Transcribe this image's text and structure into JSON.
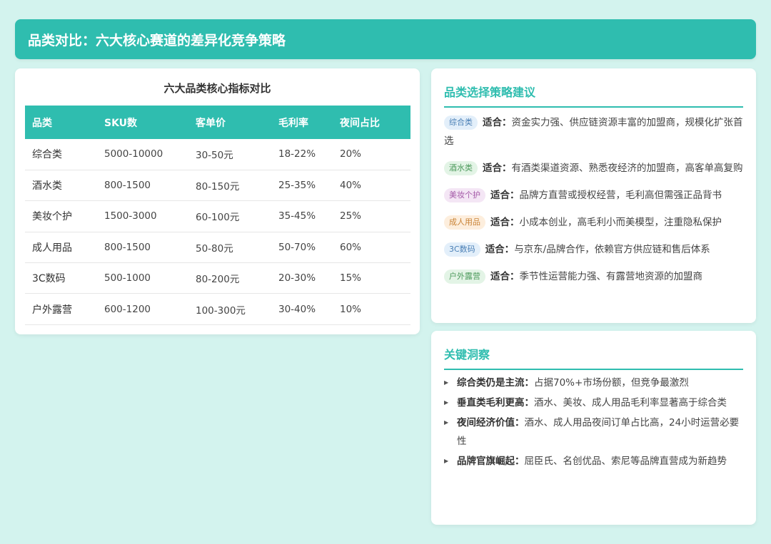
{
  "header": {
    "title": "品类对比：六大核心赛道的差异化竞争策略"
  },
  "table": {
    "title": "六大品类核心指标对比",
    "columns": [
      "品类",
      "SKU数",
      "客单价",
      "毛利率",
      "夜间占比"
    ],
    "rows": [
      [
        "综合类",
        "5000-10000",
        "30-50元",
        "18-22%",
        "20%"
      ],
      [
        "酒水类",
        "800-1500",
        "80-150元",
        "25-35%",
        "40%"
      ],
      [
        "美妆个护",
        "1500-3000",
        "60-100元",
        "35-45%",
        "25%"
      ],
      [
        "成人用品",
        "800-1500",
        "50-80元",
        "50-70%",
        "60%"
      ],
      [
        "3C数码",
        "500-1000",
        "80-200元",
        "20-30%",
        "15%"
      ],
      [
        "户外露营",
        "600-1200",
        "100-300元",
        "30-40%",
        "10%"
      ]
    ]
  },
  "strategy": {
    "title": "品类选择策略建议",
    "fit_label": "适合：",
    "items": [
      {
        "tag": "综合类",
        "text": "资金实力强、供应链资源丰富的加盟商，规模化扩张首选",
        "tag_bg": "#e3effa",
        "tag_color": "#4a7fb5"
      },
      {
        "tag": "酒水类",
        "text": "有酒类渠道资源、熟悉夜经济的加盟商，高客单高复购",
        "tag_bg": "#e3f4e6",
        "tag_color": "#4d9a5c"
      },
      {
        "tag": "美妆个护",
        "text": "品牌方直营或授权经营，毛利高但需强正品背书",
        "tag_bg": "#f4e6f5",
        "tag_color": "#a45aa8"
      },
      {
        "tag": "成人用品",
        "text": "小成本创业，高毛利小而美模型，注重隐私保护",
        "tag_bg": "#fdeedd",
        "tag_color": "#c98336"
      },
      {
        "tag": "3C数码",
        "text": "与京东/品牌合作，依赖官方供应链和售后体系",
        "tag_bg": "#e3effa",
        "tag_color": "#4a7fb5"
      },
      {
        "tag": "户外露营",
        "text": "季节性运营能力强、有露营地资源的加盟商",
        "tag_bg": "#e3f4e6",
        "tag_color": "#4d9a5c"
      }
    ]
  },
  "insight": {
    "title": "关键洞察",
    "bullet": "▶",
    "items": [
      {
        "label": "综合类仍是主流：",
        "text": "占据70%+市场份额，但竞争最激烈"
      },
      {
        "label": "垂直类毛利更高：",
        "text": "酒水、美妆、成人用品毛利率显著高于综合类"
      },
      {
        "label": "夜间经济价值：",
        "text": "酒水、成人用品夜间订单占比高，24小时运营必要性"
      },
      {
        "label": "品牌官旗崛起：",
        "text": "屈臣氏、名创优品、索尼等品牌直营成为新趋势"
      }
    ]
  }
}
